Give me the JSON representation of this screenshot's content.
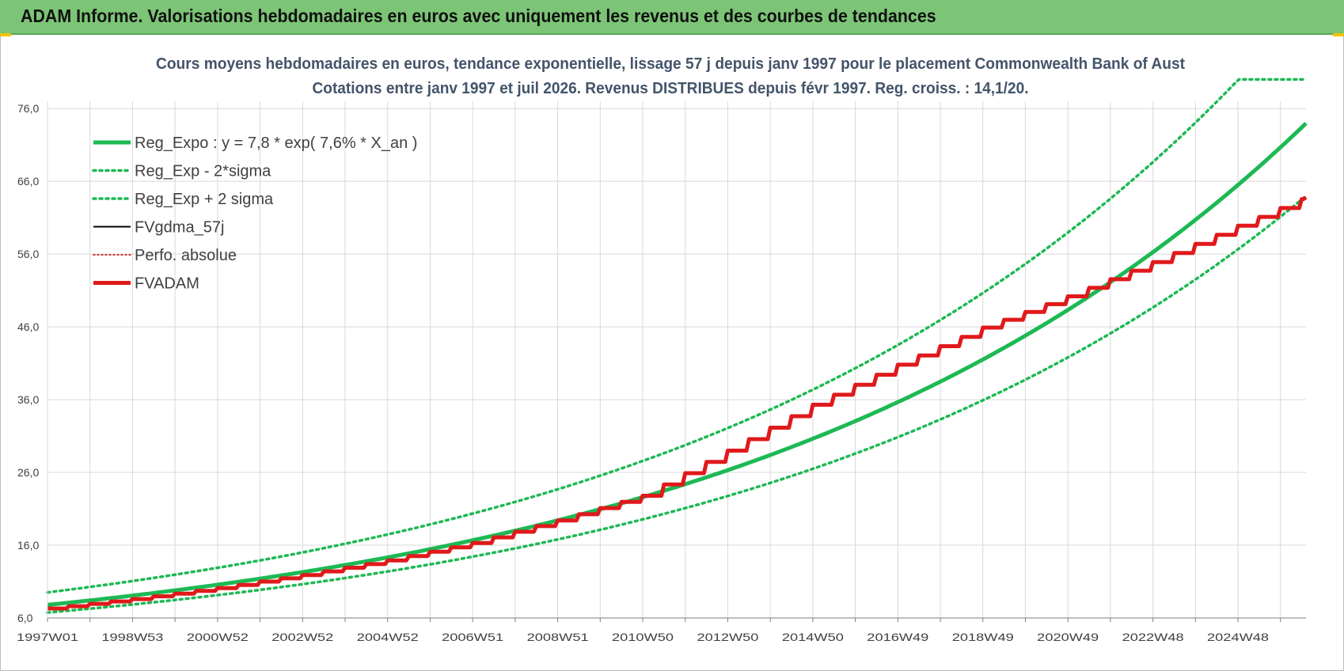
{
  "header": {
    "title": "ADAM Informe. Valorisations hebdomadaires en euros avec uniquement les revenus et des courbes de tendances"
  },
  "colors": {
    "header_bg": "#7cc576",
    "trend_green": "#1db954",
    "fvadam_red": "#e0191b",
    "fvgdma_black": "#000000",
    "perfo_red": "#c00000",
    "grid": "#d9d9d9"
  },
  "chart_data": {
    "type": "line",
    "title_line1": "Cours moyens hebdomadaires en euros, tendance exponentielle, lissage 57 j depuis janv 1997 pour le placement Commonwealth Bank of Aust",
    "title_line2": "Cotations entre janv 1997 et juil 2026. Revenus DISTRIBUES depuis févr 1997. Reg. croiss. : 14,1/20.",
    "y_ticks": [
      "76,0",
      "66,0",
      "56,0",
      "46,0",
      "36,0",
      "26,0",
      "16,0",
      "6,0"
    ],
    "ylim": [
      6,
      77
    ],
    "x_tick_labels": [
      "1997W01",
      "1998W53",
      "2000W52",
      "2002W52",
      "2004W52",
      "2006W51",
      "2008W51",
      "2010W50",
      "2012W50",
      "2014W50",
      "2016W49",
      "2018W49",
      "2020W49",
      "2022W48",
      "2024W48"
    ],
    "x_tick_years": [
      1997.0,
      1999.0,
      2001.0,
      2003.0,
      2005.0,
      2007.0,
      2009.0,
      2011.0,
      2013.0,
      2015.0,
      2017.0,
      2019.0,
      2021.0,
      2023.0,
      2025.0
    ],
    "xlim": [
      1997.0,
      2026.6
    ],
    "grid": true,
    "legend_position": "top-left",
    "regression": {
      "a": 7.8,
      "rate": 0.076,
      "lower_factor": 0.865,
      "upper_factor": 1.22,
      "upper_cap": 80
    },
    "series": [
      {
        "name": "Reg_Expo : y = 7,8 * exp( 7,6% *  X_an )",
        "style": "solid-thick",
        "color": "#1db954",
        "x": [
          1997.0,
          2000.0,
          2003.0,
          2006.0,
          2009.0,
          2012.0,
          2015.0,
          2018.0,
          2021.0,
          2024.0,
          2026.6
        ],
        "values": [
          7.8,
          9.8,
          12.3,
          15.5,
          19.5,
          24.5,
          30.8,
          38.7,
          48.6,
          61.2,
          74.5
        ]
      },
      {
        "name": "Reg_Exp - 2*sigma",
        "style": "dotted",
        "color": "#1db954",
        "x": [
          1997.0,
          2000.0,
          2003.0,
          2006.0,
          2009.0,
          2012.0,
          2015.0,
          2018.0,
          2021.0,
          2024.0,
          2026.6
        ],
        "values": [
          6.7,
          8.5,
          10.6,
          13.4,
          16.9,
          21.2,
          26.6,
          33.5,
          42.0,
          52.9,
          66.5
        ]
      },
      {
        "name": "Reg_Exp + 2 sigma",
        "style": "dotted",
        "color": "#1db954",
        "x": [
          1997.0,
          2000.0,
          2003.0,
          2006.0,
          2009.0,
          2012.0,
          2015.0,
          2018.0,
          2021.0,
          2024.0,
          2026.6
        ],
        "values": [
          9.5,
          11.9,
          15.0,
          18.9,
          23.8,
          29.9,
          37.6,
          47.2,
          59.3,
          74.6,
          80.0
        ]
      },
      {
        "name": "FVgdma_57j",
        "style": "solid-thin",
        "color": "#000000",
        "x": [
          1997.0,
          1999.0,
          2001.0,
          2003.0,
          2005.0,
          2007.0,
          2009.0,
          2011.0,
          2013.0,
          2015.0,
          2017.0,
          2019.0,
          2021.0,
          2023.0,
          2025.0,
          2026.6
        ],
        "values": [
          7.3,
          8.6,
          10.1,
          11.9,
          13.9,
          16.3,
          19.4,
          22.8,
          29.0,
          35.3,
          40.8,
          45.9,
          50.2,
          54.9,
          59.9,
          63.8
        ]
      },
      {
        "name": "Perfo. absolue",
        "style": "dotted-thin",
        "color": "#c00000",
        "x": [
          1997.0,
          1999.0,
          2001.0,
          2003.0,
          2005.0,
          2007.0,
          2009.0,
          2011.0,
          2013.0,
          2015.0,
          2017.0,
          2019.0,
          2021.0,
          2023.0,
          2025.0,
          2026.6
        ],
        "values": [
          7.3,
          8.6,
          10.1,
          11.9,
          13.9,
          16.3,
          19.4,
          22.8,
          29.0,
          35.3,
          40.8,
          45.9,
          50.2,
          54.9,
          59.9,
          63.8
        ]
      },
      {
        "name": "FVADAM",
        "style": "solid-thick",
        "color": "#e0191b",
        "x": [
          1997.0,
          1999.0,
          2001.0,
          2003.0,
          2005.0,
          2007.0,
          2009.0,
          2011.0,
          2013.0,
          2015.0,
          2017.0,
          2019.0,
          2021.0,
          2023.0,
          2025.0,
          2026.6
        ],
        "values": [
          7.3,
          8.6,
          10.1,
          11.9,
          13.9,
          16.3,
          19.4,
          22.8,
          29.0,
          35.3,
          40.8,
          45.9,
          50.2,
          54.9,
          59.9,
          63.8
        ]
      }
    ]
  }
}
